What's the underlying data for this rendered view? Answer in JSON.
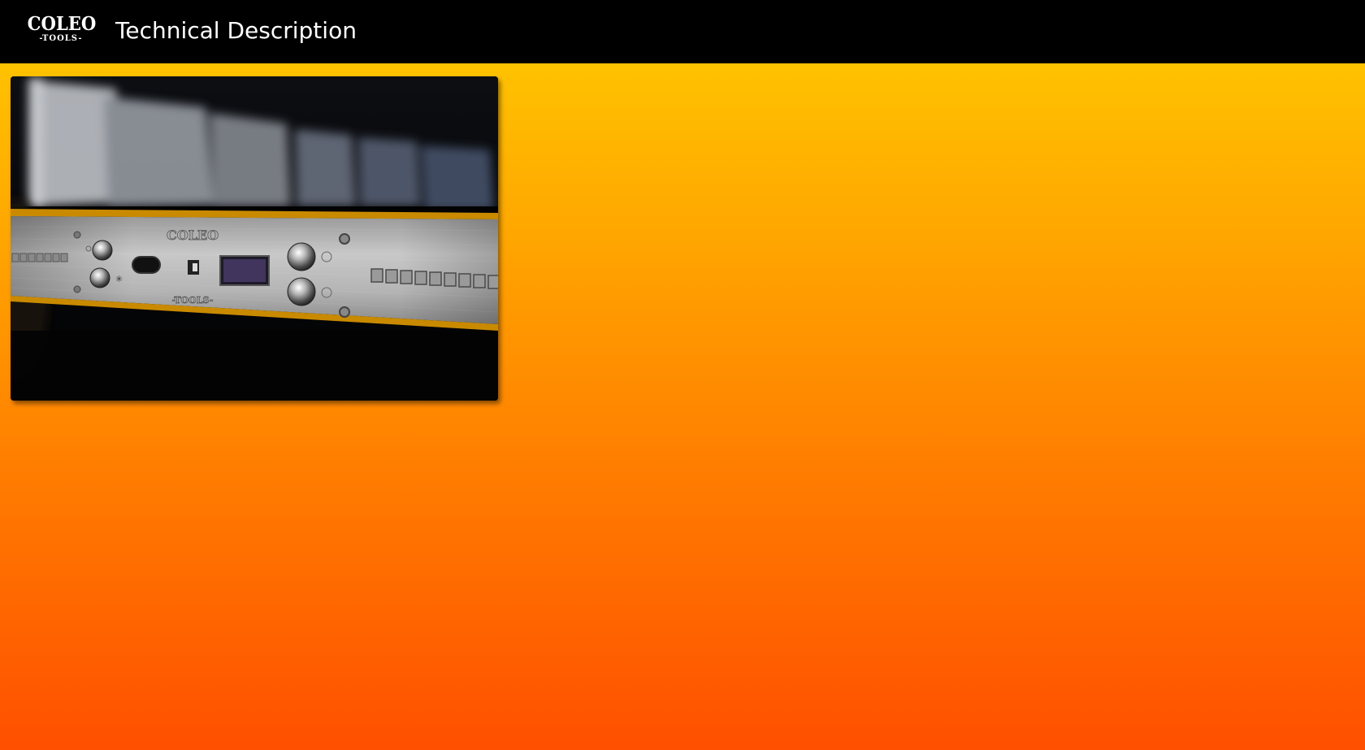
{
  "header": {
    "logo": {
      "main": "COLEO",
      "sub": "-TOOLS-"
    },
    "title": "Technical Description"
  },
  "photo": {
    "subject": "device-front-panel",
    "panel_brand": "COLEO",
    "panel_sub": "-TOOLS-"
  },
  "colors": {
    "header_bg": "#000000",
    "gradient_top": "#ffcc00",
    "gradient_bottom": "#ff4f00"
  }
}
